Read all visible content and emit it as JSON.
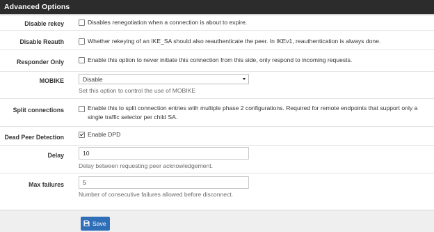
{
  "panel": {
    "title": "Advanced Options"
  },
  "rows": {
    "disable_rekey": {
      "label": "Disable rekey",
      "text": "Disables renegotiation when a connection is about to expire.",
      "checked": false
    },
    "disable_reauth": {
      "label": "Disable Reauth",
      "text": "Whether rekeying of an IKE_SA should also reauthenticate the peer. In IKEv1, reauthentication is always done.",
      "checked": false
    },
    "responder_only": {
      "label": "Responder Only",
      "text": "Enable this option to never initiate this connection from this side, only respond to incoming requests.",
      "checked": false
    },
    "mobike": {
      "label": "MOBIKE",
      "value": "Disable",
      "help": "Set this option to control the use of MOBIKE"
    },
    "split_connections": {
      "label": "Split connections",
      "text": "Enable this to split connection entries with multiple phase 2 configurations. Required for remote endpoints that support only a single traffic selector per child SA.",
      "checked": false
    },
    "dpd": {
      "label": "Dead Peer Detection",
      "text": "Enable DPD",
      "checked": true
    },
    "delay": {
      "label": "Delay",
      "value": "10",
      "help": "Delay between requesting peer acknowledgement."
    },
    "max_failures": {
      "label": "Max failures",
      "value": "5",
      "help": "Number of consecutive failures allowed before disconnect."
    }
  },
  "actions": {
    "save_label": "Save"
  },
  "icons": {
    "save": "floppy-disk-icon",
    "dropdown": "caret-down-icon",
    "checkbox_checked": "checkmark-icon"
  },
  "colors": {
    "header_bg": "#2c2c2c",
    "primary_button": "#2f6fb8"
  }
}
